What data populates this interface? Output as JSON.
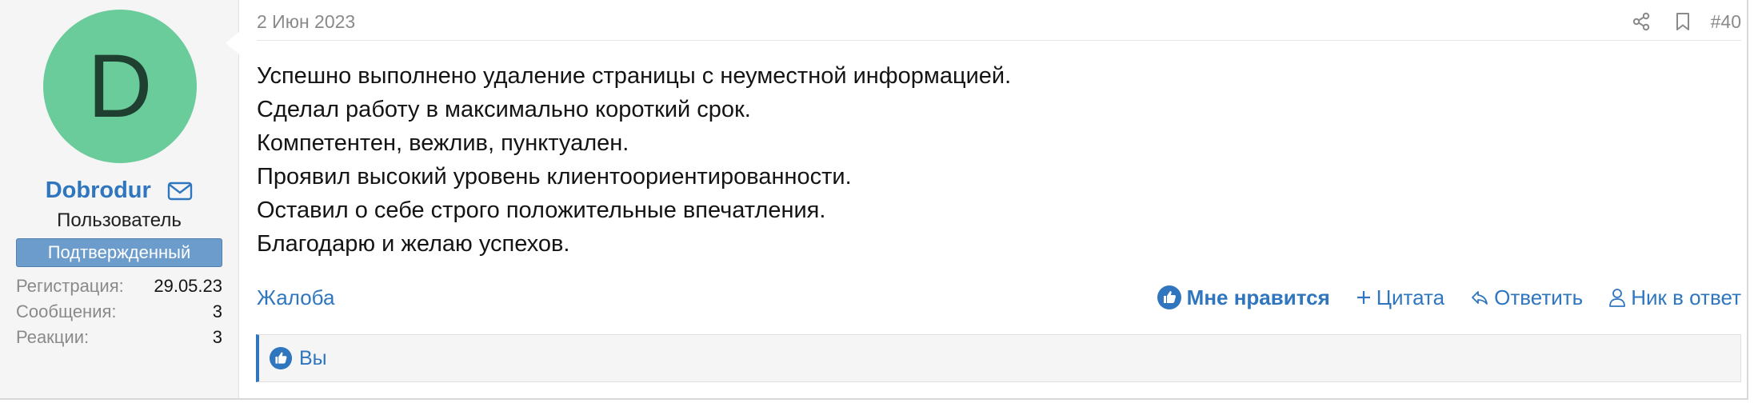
{
  "user": {
    "avatar_letter": "D",
    "username": "Dobrodur",
    "title": "Пользователь",
    "banner": "Подтвержденный",
    "stats": [
      {
        "label": "Регистрация:",
        "value": "29.05.23"
      },
      {
        "label": "Сообщения:",
        "value": "3"
      },
      {
        "label": "Реакции:",
        "value": "3"
      }
    ]
  },
  "post": {
    "date": "2 Июн 2023",
    "number": "#40",
    "lines": [
      "Успешно выполнено удаление страницы с неуместной информацией.",
      "Сделал работу в максимально короткий срок.",
      "Компетентен, вежлив, пунктуален.",
      "Проявил высокий уровень клиентоориентированности.",
      "Оставил о себе строго положительные впечатления.",
      "Благодарю и желаю успехов."
    ]
  },
  "actions": {
    "report": "Жалоба",
    "like": "Мне нравится",
    "quote": "Цитата",
    "reply": "Ответить",
    "mention": "Ник в ответ"
  },
  "reactions": {
    "text": "Вы"
  },
  "colors": {
    "accent": "#2f76bf",
    "avatar_bg": "#6acb9b",
    "banner_bg": "#6c9ccc"
  }
}
